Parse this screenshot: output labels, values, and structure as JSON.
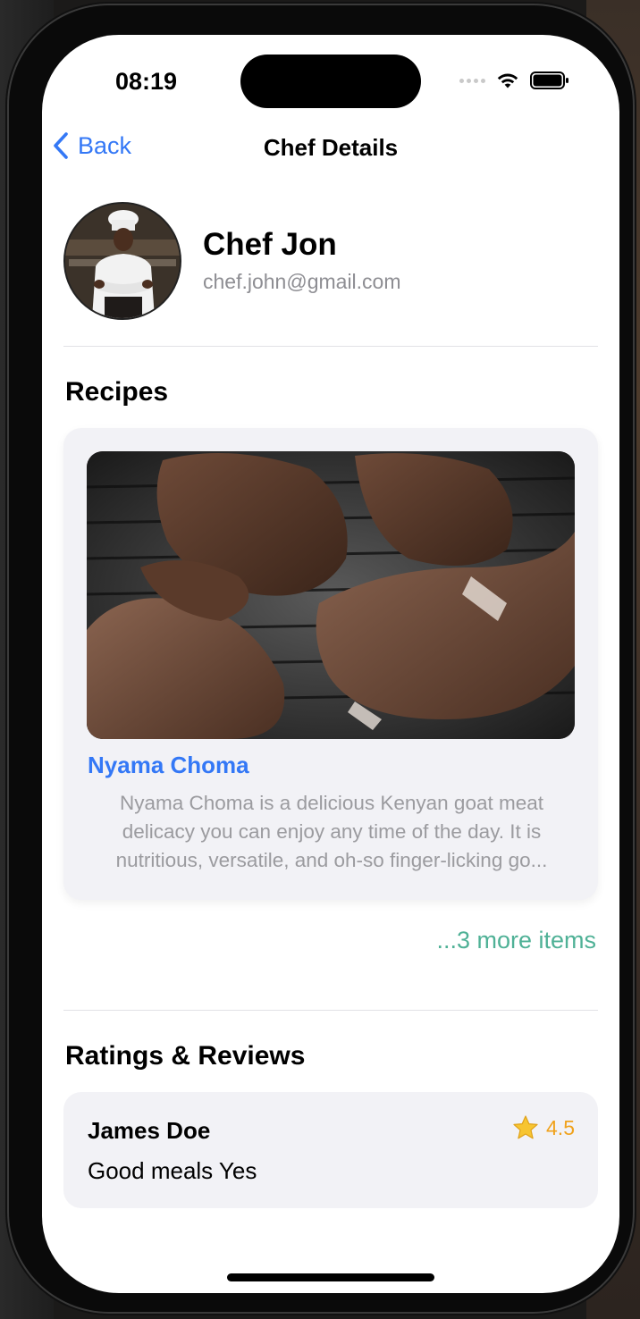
{
  "status_bar": {
    "time": "08:19"
  },
  "nav": {
    "back_label": "Back",
    "title": "Chef Details"
  },
  "chef": {
    "name": "Chef Jon",
    "email": "chef.john@gmail.com"
  },
  "recipes": {
    "section_title": "Recipes",
    "items": [
      {
        "title": "Nyama Choma",
        "description": "Nyama Choma is a delicious Kenyan goat meat delicacy you can enjoy any time of the day. It is nutritious, versatile, and oh-so finger-licking go..."
      }
    ],
    "more_label": "...3 more items"
  },
  "reviews": {
    "section_title": "Ratings & Reviews",
    "items": [
      {
        "reviewer": "James Doe",
        "rating": "4.5",
        "text": "Good meals Yes"
      }
    ]
  },
  "colors": {
    "accent": "#3478f6",
    "more_link": "#4fb196",
    "rating": "#f0a21c",
    "card_bg": "#f2f2f6"
  }
}
